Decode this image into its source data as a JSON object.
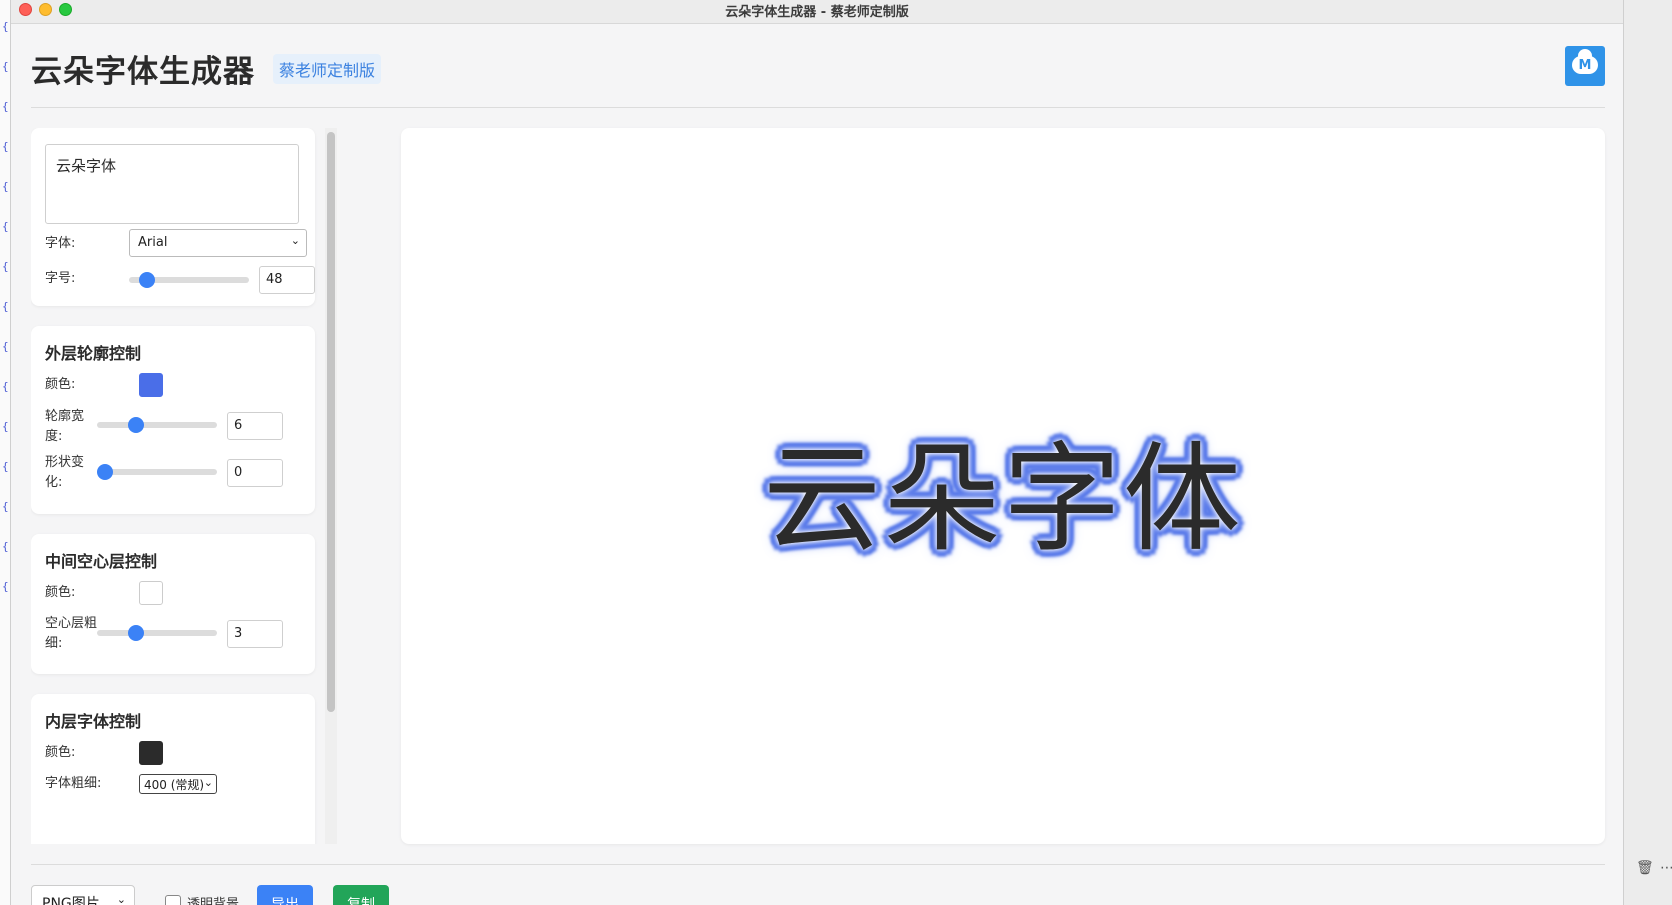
{
  "window": {
    "title": "云朵字体生成器 - 蔡老师定制版"
  },
  "header": {
    "title": "云朵字体生成器",
    "badge": "蔡老师定制版",
    "logo_text": "M"
  },
  "basic": {
    "text_value": "云朵字体",
    "font_label": "字体:",
    "font_value": "Arial",
    "size_label": "字号:",
    "size_value": "48",
    "size_level": 0.15
  },
  "outer": {
    "title": "外层轮廓控制",
    "color_label": "颜色:",
    "color": "#4a6ee8",
    "width_label": "轮廓宽度:",
    "width_value": "6",
    "shape_label": "形状变化:",
    "shape_value": "0"
  },
  "middle": {
    "title": "中间空心层控制",
    "color_label": "颜色:",
    "color": "#ffffff",
    "thickness_label": "空心层粗细:",
    "thickness_value": "3"
  },
  "inner": {
    "title": "内层字体控制",
    "color_label": "颜色:",
    "color": "#2b2b2b",
    "weight_label": "字体粗细:",
    "weight_value": "400 (常规)"
  },
  "preview": {
    "text": "云朵字体"
  },
  "bottom": {
    "format_value": "PNG图片",
    "transparent_label": "透明背景",
    "export_label": "导出",
    "copy_label": "复制"
  },
  "icons": {
    "trash": "trash-icon",
    "more": "more-icon"
  }
}
